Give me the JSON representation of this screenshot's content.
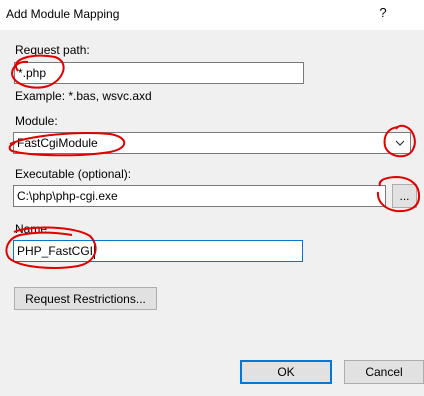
{
  "dialog": {
    "title": "Add Module Mapping",
    "help_label": "?"
  },
  "request_path": {
    "label": "Request path:",
    "value": "*.php",
    "example": "Example: *.bas, wsvc.axd"
  },
  "module": {
    "label": "Module:",
    "value": "FastCgiModule",
    "dropdown_icon": "chevron-down-icon"
  },
  "executable": {
    "label": "Executable (optional):",
    "value": "C:\\php\\php-cgi.exe",
    "browse_label": "..."
  },
  "name": {
    "label": "Name:",
    "value": "PHP_FastCGI"
  },
  "buttons": {
    "request_restrictions": "Request Restrictions...",
    "ok": "OK",
    "cancel": "Cancel"
  },
  "colors": {
    "annotation": "#e00000",
    "focus_border": "#0078d7",
    "dialog_background": "#f0f0f0"
  }
}
